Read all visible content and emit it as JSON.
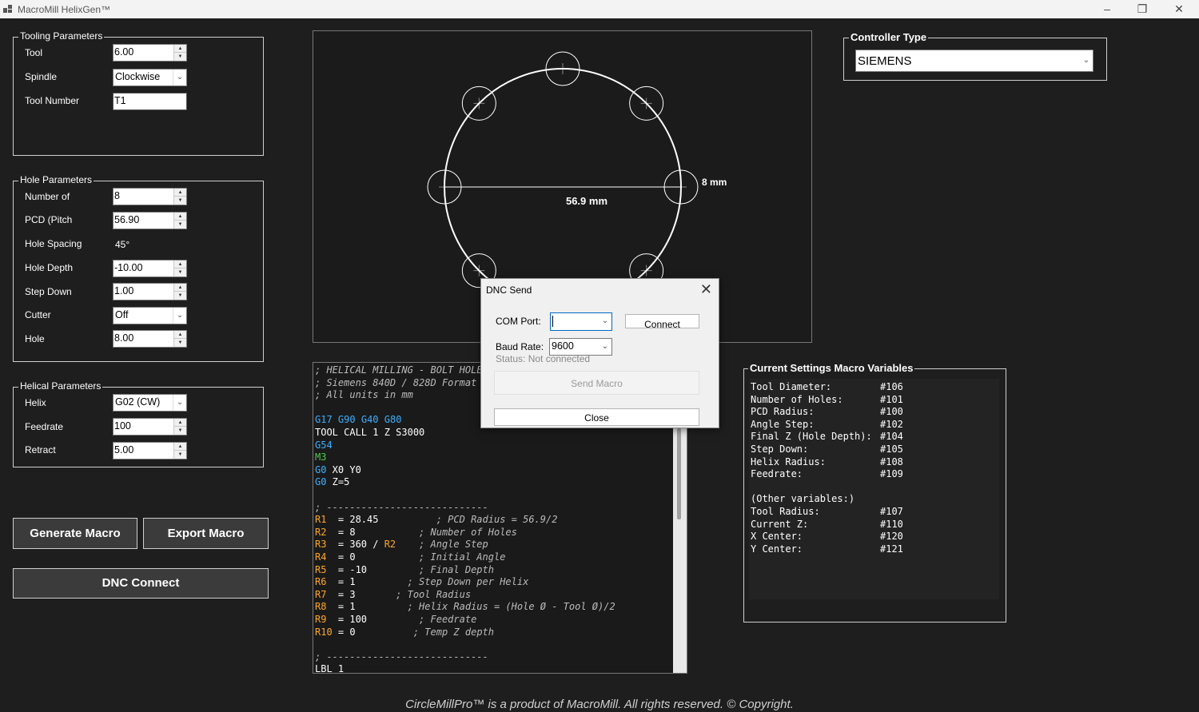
{
  "window": {
    "title": "MacroMill HelixGen™"
  },
  "tooling": {
    "legend": "Tooling Parameters",
    "tool_label": "Tool",
    "tool_value": "6.00",
    "spindle_label": "Spindle",
    "spindle_value": "Clockwise",
    "tool_number_label": "Tool Number",
    "tool_number_value": "T1"
  },
  "hole": {
    "legend": "Hole Parameters",
    "number_label": "Number of",
    "number_value": "8",
    "pcd_label": "PCD (Pitch",
    "pcd_value": "56.90",
    "spacing_label": "Hole Spacing",
    "spacing_value": "45°",
    "depth_label": "Hole Depth",
    "depth_value": "-10.00",
    "step_label": "Step Down",
    "step_value": "1.00",
    "cutter_label": "Cutter",
    "cutter_value": "Off",
    "hole_label": "Hole",
    "hole_value": "8.00"
  },
  "helical": {
    "legend": "Helical Parameters",
    "helix_label": "Helix",
    "helix_value": "G02 (CW)",
    "feedrate_label": "Feedrate",
    "feedrate_value": "100",
    "retract_label": "Retract",
    "retract_value": "5.00"
  },
  "buttons": {
    "generate": "Generate Macro",
    "export": "Export Macro",
    "dnc": "DNC Connect"
  },
  "controller": {
    "legend": "Controller Type",
    "value": "SIEMENS"
  },
  "preview": {
    "pcd_label": "56.9 mm",
    "hole_label": "8 mm",
    "hole_count": 8
  },
  "code": {
    "lines": [
      "; HELICAL MILLING - BOLT HOLE",
      "; Siemens 840D / 828D Format",
      "; All units in mm",
      "",
      "G17 G90 G40 G80",
      "TOOL CALL 1 Z S3000",
      "G54",
      "M3",
      "G0 X0 Y0",
      "G0 Z=5",
      "",
      "; ----------------------------",
      "R1  = 28.45          ; PCD Radius = 56.9/2",
      "R2  = 8           ; Number of Holes",
      "R3  = 360 / R2    ; Angle Step",
      "R4  = 0           ; Initial Angle",
      "R5  = -10         ; Final Depth",
      "R6  = 1         ; Step Down per Helix",
      "R7  = 3       ; Tool Radius",
      "R8  = 1         ; Helix Radius = (Hole Ø - Tool Ø)/2",
      "R9  = 100         ; Feedrate",
      "R10 = 0          ; Temp Z depth",
      "",
      "; ----------------------------",
      "LBL 1"
    ]
  },
  "settings": {
    "legend": "Current Settings  Macro Variables",
    "rows": [
      {
        "k": "Tool Diameter:",
        "v": "#106"
      },
      {
        "k": "Number of Holes:",
        "v": "#101"
      },
      {
        "k": "PCD Radius:",
        "v": "#100"
      },
      {
        "k": "Angle Step:",
        "v": "#102"
      },
      {
        "k": "Final Z (Hole Depth):",
        "v": "#104"
      },
      {
        "k": "Step Down:",
        "v": "#105"
      },
      {
        "k": "Helix Radius:",
        "v": "#108"
      },
      {
        "k": "Feedrate:",
        "v": "#109"
      },
      {
        "k": "",
        "v": ""
      },
      {
        "k": "(Other variables:)",
        "v": ""
      },
      {
        "k": "Tool Radius:",
        "v": "#107"
      },
      {
        "k": "Current Z:",
        "v": "#110"
      },
      {
        "k": "X Center:",
        "v": "#120"
      },
      {
        "k": "Y Center:",
        "v": "#121"
      }
    ]
  },
  "dialog": {
    "title": "DNC Send",
    "com_label": "COM Port:",
    "com_value": "",
    "connect": "Connect",
    "baud_label": "Baud Rate:",
    "baud_value": "9600",
    "status": "Status: Not connected",
    "send": "Send Macro",
    "close": "Close"
  },
  "footer": "CircleMillPro™ is a product of MacroMill. All rights reserved. © Copyright."
}
